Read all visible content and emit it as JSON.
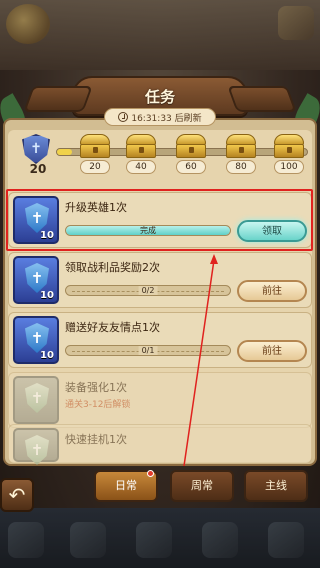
{
  "header": {
    "title": "任务",
    "refresh_text": "16:31:33 后刷新"
  },
  "progress": {
    "current": "20",
    "fraction": 0.06,
    "milestones": [
      "20",
      "40",
      "60",
      "80",
      "100"
    ]
  },
  "tasks": [
    {
      "name": "升级英雄1次",
      "level": "10",
      "bar_text": "完成",
      "progress": 1.0,
      "button": "领取",
      "state": "claim"
    },
    {
      "name": "领取战利品奖励2次",
      "level": "10",
      "bar_text": "0/2",
      "progress": 0.0,
      "button": "前往",
      "state": "go"
    },
    {
      "name": "赠送好友友情点1次",
      "level": "10",
      "bar_text": "0/1",
      "progress": 0.0,
      "button": "前往",
      "state": "go"
    },
    {
      "name": "装备强化1次",
      "level": "",
      "sub": "通关3-12后解锁",
      "state": "locked"
    },
    {
      "name": "快速挂机1次",
      "level": "",
      "state": "locked"
    }
  ],
  "tabs": [
    "日常",
    "周常",
    "主线"
  ],
  "colors": {
    "highlight": "#e0221e",
    "claim": "#6ad4ca",
    "accent": "#f0d24a"
  }
}
